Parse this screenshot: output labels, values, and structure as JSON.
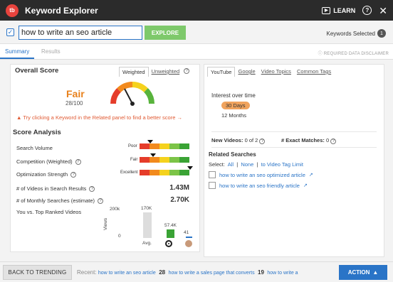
{
  "app": {
    "logo_text": "tb",
    "title": "Keyword Explorer",
    "learn_label": "LEARN",
    "help_glyph": "?",
    "close_glyph": "✕"
  },
  "search": {
    "query": "how to write an seo article",
    "explore_label": "EXPLORE",
    "keywords_selected_label": "Keywords Selected",
    "keywords_selected_count": "1"
  },
  "tabs": {
    "summary": "Summary",
    "results": "Results",
    "disclaimer": "REQUIRED DATA DISCLAIMER"
  },
  "overall": {
    "title": "Overall Score",
    "weighted": "Weighted",
    "unweighted": "Unweighted",
    "rating": "Fair",
    "score": "28/100",
    "warning": "Try clicking a Keyword in the Related panel to find a better score →"
  },
  "analysis": {
    "title": "Score Analysis",
    "rows": [
      {
        "label": "Search Volume",
        "level": "Poor"
      },
      {
        "label": "Competition (Weighted)",
        "level": "Fair"
      },
      {
        "label": "Optimization Strength",
        "level": "Excellent"
      }
    ],
    "videos_label": "# of Videos in Search Results",
    "videos_value": "1.43M",
    "monthly_label": "# of Monthly Searches (estimate)",
    "monthly_value": "2.70K",
    "you_vs_label": "You vs. Top Ranked Videos"
  },
  "chart_data": {
    "type": "bar",
    "ylabel": "Views",
    "yticks": [
      "200k",
      "0"
    ],
    "categories": [
      "Avg.",
      "target",
      "you"
    ],
    "values": [
      170000,
      57400,
      41
    ],
    "value_labels": [
      "170K",
      "57.4K",
      "41"
    ],
    "colors": [
      "#dddddd",
      "#3aa335",
      "#2a74c7"
    ],
    "ylim": [
      0,
      200000
    ]
  },
  "right": {
    "tabs": [
      "YouTube",
      "Google",
      "Video Topics",
      "Common Tags"
    ],
    "interest_title": "Interest over time",
    "period_active": "30 Days",
    "period_other": "12 Months",
    "new_videos_label": "New Videos:",
    "new_videos_value": "0 of 2",
    "exact_label": "# Exact Matches:",
    "exact_value": "0",
    "related_title": "Related Searches",
    "select_label": "Select:",
    "select_all": "All",
    "select_none": "None",
    "select_tag": "to Video Tag Limit",
    "related": [
      "how to write an seo optimized article",
      "how to write an seo friendly article"
    ]
  },
  "bottom": {
    "back_label": "BACK TO TRENDING",
    "recent_label": "Recent:",
    "recent_items": [
      {
        "text": "how to write an seo article",
        "count": "28"
      },
      {
        "text": "how to write a sales page that converts",
        "count": "19"
      },
      {
        "text": "how to write a",
        "count": ""
      }
    ],
    "action_label": "ACTION"
  },
  "colors": {
    "accent": "#2a74c7",
    "explore": "#7ec96b",
    "fair": "#e8811c",
    "warning": "#e05a33"
  }
}
